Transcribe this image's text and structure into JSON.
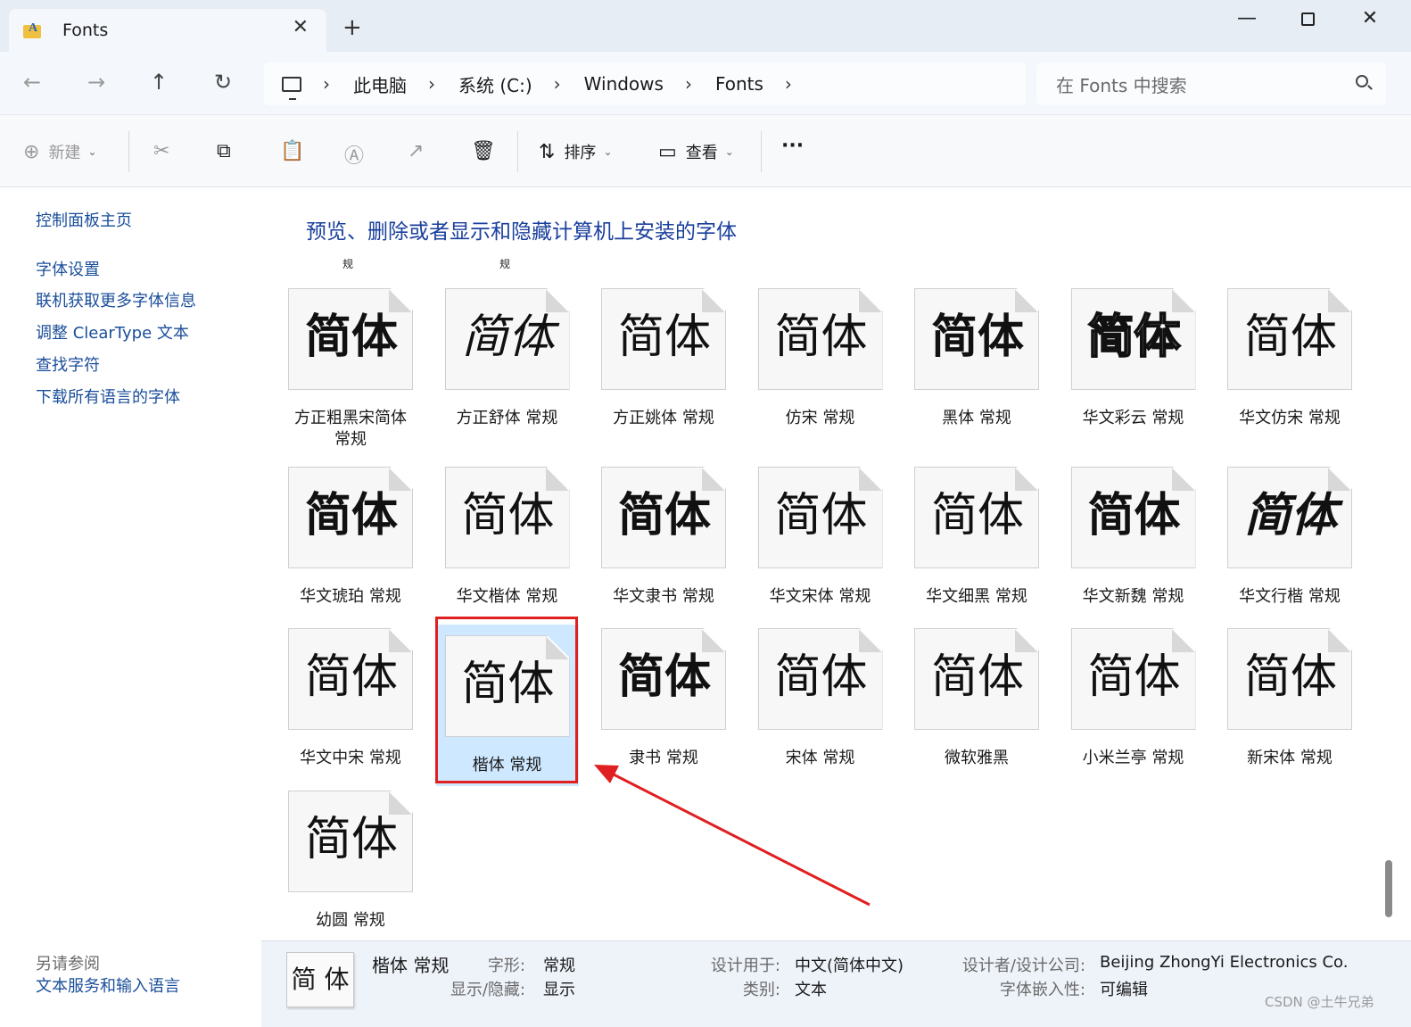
{
  "window": {
    "tab_title": "Fonts",
    "close_tab_glyph": "✕",
    "new_tab_glyph": "+",
    "minimize_glyph": "—",
    "close_glyph": "✕"
  },
  "nav": {
    "back_glyph": "←",
    "forward_glyph": "→",
    "up_glyph": "↑",
    "refresh_glyph": "↻",
    "breadcrumbs": [
      "此电脑",
      "系统 (C:)",
      "Windows",
      "Fonts"
    ],
    "sep_glyph": "›",
    "search_placeholder": "在 Fonts 中搜索"
  },
  "toolbar": {
    "new_label": "新建",
    "new_icon_glyph": "⊕",
    "cut_icon_glyph": "✂",
    "copy_icon_glyph": "⧉",
    "paste_icon_glyph": "📋",
    "rename_icon_glyph": "Ⓐ",
    "share_icon_glyph": "↗",
    "delete_icon_glyph": "🗑",
    "sort_label": "排序",
    "sort_icon_glyph": "⇅",
    "view_label": "查看",
    "view_icon_glyph": "▭",
    "more_glyph": "···",
    "chevron_glyph": "⌄"
  },
  "sidebar": {
    "links": [
      "控制面板主页",
      "字体设置",
      "联机获取更多字体信息",
      "调整 ClearType 文本",
      "查找字符",
      "下载所有语言的字体"
    ],
    "see_also_title": "另请参阅",
    "see_also_links": [
      "文本服务和输入语言"
    ]
  },
  "main": {
    "heading": "预览、删除或者显示和隐藏计算机上安装的字体",
    "clipped_labels": [
      "规",
      "规"
    ],
    "preview_text": "简体",
    "fonts": [
      {
        "label": "方正粗黑宋简体 常规"
      },
      {
        "label": "方正舒体 常规"
      },
      {
        "label": "方正姚体 常规"
      },
      {
        "label": "仿宋 常规"
      },
      {
        "label": "黑体 常规"
      },
      {
        "label": "华文彩云 常规"
      },
      {
        "label": "华文仿宋 常规"
      },
      {
        "label": "华文琥珀 常规"
      },
      {
        "label": "华文楷体 常规"
      },
      {
        "label": "华文隶书 常规"
      },
      {
        "label": "华文宋体 常规"
      },
      {
        "label": "华文细黑 常规"
      },
      {
        "label": "华文新魏 常规"
      },
      {
        "label": "华文行楷 常规"
      },
      {
        "label": "华文中宋 常规"
      },
      {
        "label": "楷体 常规",
        "selected": true
      },
      {
        "label": "隶书 常规"
      },
      {
        "label": "宋体 常规"
      },
      {
        "label": "微软雅黑",
        "family": true
      },
      {
        "label": "小米兰亭 常规"
      },
      {
        "label": "新宋体 常规"
      },
      {
        "label": "幼圆 常规"
      }
    ]
  },
  "details": {
    "thumb_text": "简 体",
    "name": "楷体 常规",
    "style_label": "字形:",
    "style_value": "常规",
    "showhide_label": "显示/隐藏:",
    "showhide_value": "显示",
    "designed_for_label": "设计用于:",
    "designed_for_value": "中文(简体中文)",
    "category_label": "类别:",
    "category_value": "文本",
    "designer_label": "设计者/设计公司:",
    "designer_value": "Beijing ZhongYi Electronics Co.",
    "embed_label": "字体嵌入性:",
    "embed_value": "可编辑"
  },
  "watermark": "CSDN @土牛兄弟",
  "colors": {
    "selection": "#cde8ff",
    "highlight_box": "#e02020",
    "link": "#1a4e9a"
  }
}
